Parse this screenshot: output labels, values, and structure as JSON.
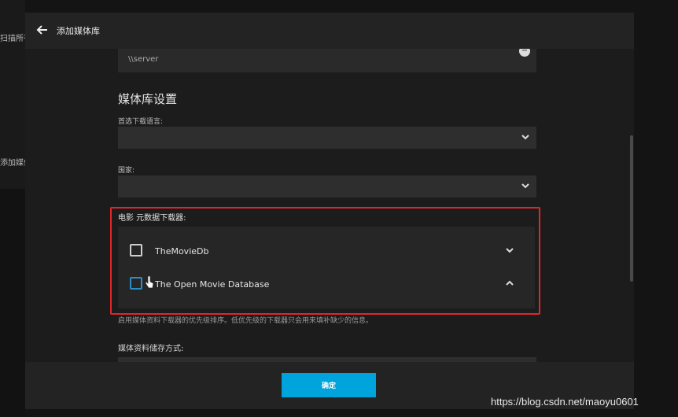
{
  "background": {
    "left_text_top": "扫描所有",
    "left_text_mid": "添加媒体"
  },
  "header": {
    "back_icon": "arrow-left-icon",
    "title": "添加媒体库"
  },
  "folder": {
    "path": "\\\\server",
    "remove_icon": "minus-circle-icon"
  },
  "settings": {
    "section_title": "媒体库设置",
    "language_label": "首选下载语言:",
    "language_value": "",
    "country_label": "国家:",
    "country_value": ""
  },
  "downloaders": {
    "label": "电影 元数据下载器:",
    "items": [
      {
        "name": "TheMovieDb",
        "checked": false,
        "chevron": "chevron-down-icon"
      },
      {
        "name": "The Open Movie Database",
        "checked": false,
        "chevron": "chevron-up-icon"
      }
    ],
    "help": "启用媒体资料下载器的优先级排序。低优先级的下载器只会用来填补缺少的信息。"
  },
  "storage": {
    "label": "媒体资料储存方式:"
  },
  "footer": {
    "ok_label": "确定"
  },
  "colors": {
    "accent": "#00a4dc",
    "highlight_border": "#e0262b",
    "dialog_bg": "#1c1c1c",
    "header_bg": "#232323"
  },
  "watermark": "https://blog.csdn.net/maoyu0601"
}
